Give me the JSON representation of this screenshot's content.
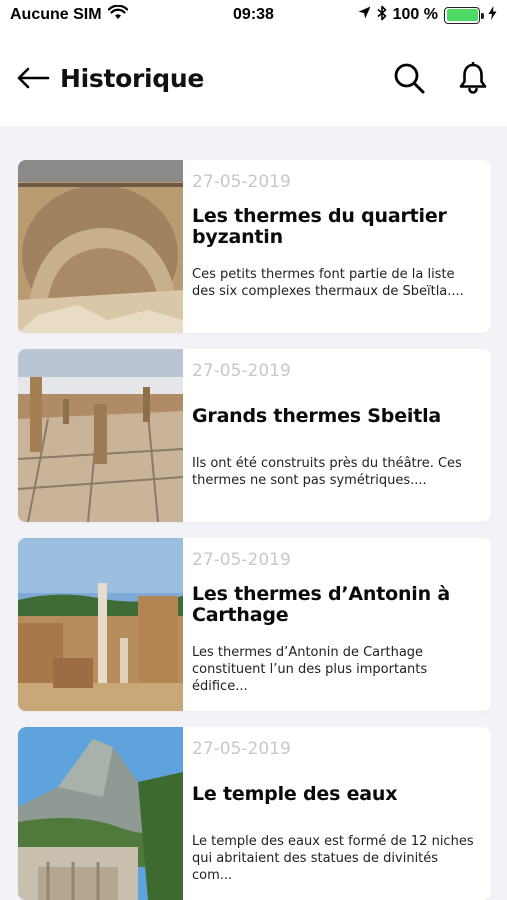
{
  "status_bar": {
    "carrier": "Aucune SIM",
    "time": "09:38",
    "battery_percent": "100 %",
    "battery_level": 1.0,
    "battery_color": "#4cd964"
  },
  "header": {
    "back_icon": "arrow-left-icon",
    "title": "Historique",
    "search_icon": "search-icon",
    "notifications_icon": "bell-icon"
  },
  "articles": [
    {
      "date": "27-05-2019",
      "title": "Les thermes du quartier byzantin",
      "excerpt": "Ces petits thermes font partie de la liste des six complexes thermaux de Sbeïtla...."
    },
    {
      "date": "27-05-2019",
      "title": "Grands thermes Sbeitla",
      "excerpt": "Ils ont été construits près du théâtre. Ces thermes ne sont pas symétriques...."
    },
    {
      "date": "27-05-2019",
      "title": "Les thermes d’Antonin à Carthage",
      "excerpt": "Les thermes d’Antonin de Carthage constituent l’un des plus importants édifice..."
    },
    {
      "date": "27-05-2019",
      "title": "Le temple des eaux",
      "excerpt": "Le temple des eaux est formé de 12 niches qui abritaient des statues de divinités com..."
    }
  ]
}
